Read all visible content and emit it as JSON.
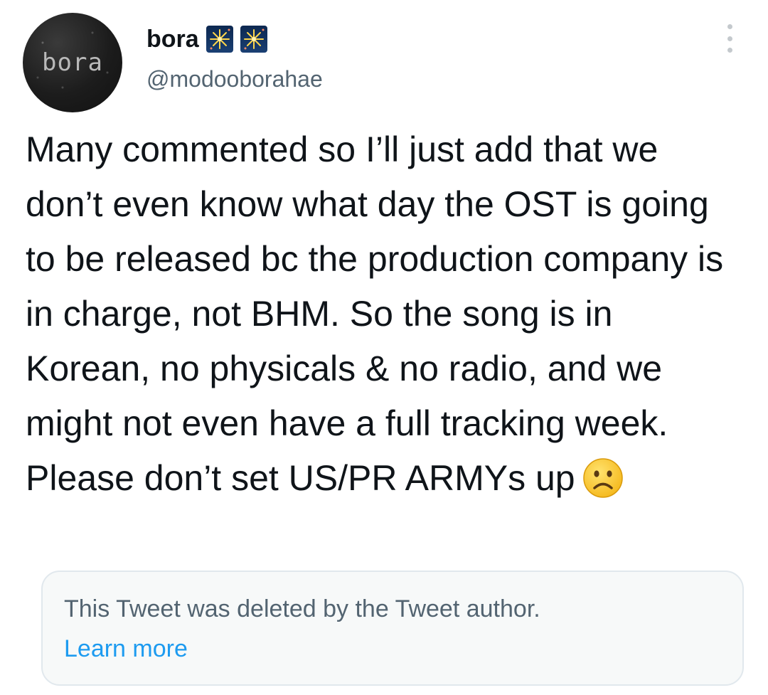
{
  "author": {
    "avatar_text": "bora",
    "display_name": "bora",
    "name_emojis": [
      "fireworks-emoji",
      "fireworks-emoji"
    ],
    "handle": "@modooborahae"
  },
  "tweet": {
    "text": "Many commented so I’ll just add that we don’t even know what day the OST is going to be released bc the production company is in charge, not BHM. So the song is in Korean, no physicals & no radio, and we might not even have a full tracking week. Please don’t set US/PR ARMYs up",
    "trailing_emoji": "frowning-face-emoji"
  },
  "quoted": {
    "deleted_message": "This Tweet was deleted by the Tweet author.",
    "learn_more": "Learn more"
  },
  "colors": {
    "text_primary": "#0f1419",
    "text_secondary": "#536471",
    "link": "#1d9bf0",
    "card_border": "#e1e8ed",
    "card_bg": "#f7f9f9"
  }
}
